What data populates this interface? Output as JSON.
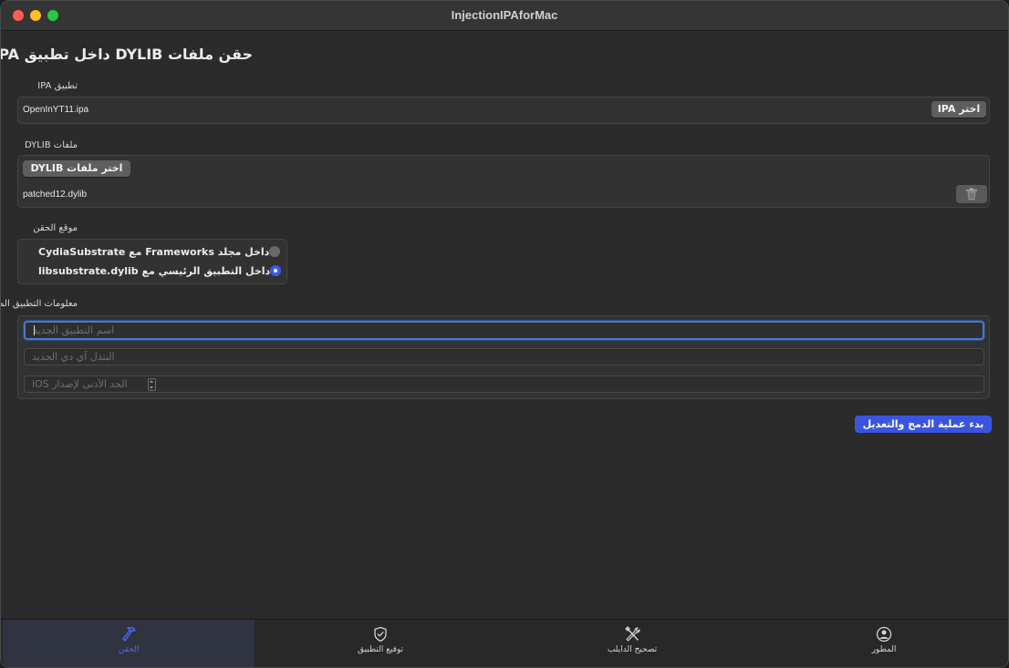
{
  "window": {
    "title": "InjectionIPAforMac"
  },
  "page": {
    "title": "حقن ملفات DYLIB داخل تطبيق IPA"
  },
  "ipa_section": {
    "label": "تطبيق IPA",
    "choose_button": "اختر IPA",
    "selected_file": "OpenInYT11.ipa"
  },
  "dylib_section": {
    "label": "ملفات DYLIB",
    "choose_button": "اختر ملفات DYLIB",
    "files": [
      "patched12.dylib"
    ],
    "delete_icon": "trash-icon"
  },
  "injection_location": {
    "label": "موقع الحقن",
    "options": [
      {
        "label": "داخل مجلد Frameworks مع CydiaSubstrate",
        "selected": false
      },
      {
        "label": "داخل التطبيق الرئيسي مع libsubstrate.dylib",
        "selected": true
      }
    ]
  },
  "modified_app_info": {
    "label": "معلومات التطبيق المعدل",
    "new_app_name": {
      "value": "",
      "placeholder": "اسم التطبيق الجديد"
    },
    "new_bundle_id": {
      "value": "",
      "placeholder": "البندل آي دي الجديد"
    },
    "min_ios_version": {
      "value": "",
      "placeholder": "الحد الأدنى لإصدار iOS"
    }
  },
  "actions": {
    "start_button": "بدء عملية الدمج والتعديل"
  },
  "tabs": [
    {
      "label": "الحقن",
      "icon": "hammer-icon",
      "active": true
    },
    {
      "label": "توقيع التطبيق",
      "icon": "shield-check-icon",
      "active": false
    },
    {
      "label": "تصحيح الدايلب",
      "icon": "tools-icon",
      "active": false
    },
    {
      "label": "المطور",
      "icon": "person-circle-icon",
      "active": false
    }
  ],
  "colors": {
    "accent": "#3b54df",
    "active_tab": "#4a6cf5",
    "focus_ring": "#4a78c8"
  }
}
